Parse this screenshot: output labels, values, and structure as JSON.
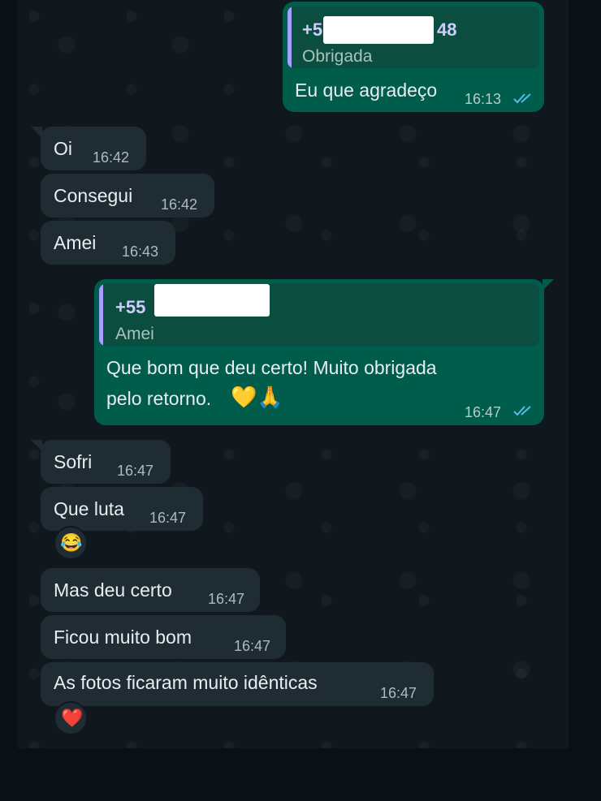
{
  "messages": {
    "m1": {
      "quote_sender": "+5",
      "quote_sender_suffix": "48",
      "quote_text": "Obrigada",
      "text": "Eu que agradeço",
      "time": "16:13",
      "direction": "outgoing",
      "status": "read"
    },
    "m2": {
      "text": "Oi",
      "time": "16:42",
      "direction": "incoming"
    },
    "m3": {
      "text": "Consegui",
      "time": "16:42",
      "direction": "incoming"
    },
    "m4": {
      "text": "Amei",
      "time": "16:43",
      "direction": "incoming"
    },
    "m5": {
      "quote_sender": "+55",
      "quote_text": "Amei",
      "text_line1": "Que bom que deu certo! Muito obrigada",
      "text_line2": "pelo retorno.",
      "emojis": "💛🙏",
      "time": "16:47",
      "direction": "outgoing",
      "status": "read"
    },
    "m6": {
      "text": "Sofri",
      "time": "16:47",
      "direction": "incoming"
    },
    "m7": {
      "text": "Que luta",
      "time": "16:47",
      "direction": "incoming",
      "reaction": "😂"
    },
    "m8": {
      "text": "Mas deu certo",
      "time": "16:47",
      "direction": "incoming"
    },
    "m9": {
      "text": "Ficou muito bom",
      "time": "16:47",
      "direction": "incoming"
    },
    "m10": {
      "text": "As fotos ficaram muito idênticas",
      "time": "16:47",
      "direction": "incoming",
      "reaction": "❤️"
    }
  },
  "colors": {
    "incoming_bubble": "#1f2c34",
    "outgoing_bubble": "#005c4b",
    "read_ticks": "#53bdeb",
    "quote_bar": "#a5a0ff",
    "background": "#11181d"
  },
  "icons": {
    "read_receipt": "double-check-icon"
  }
}
